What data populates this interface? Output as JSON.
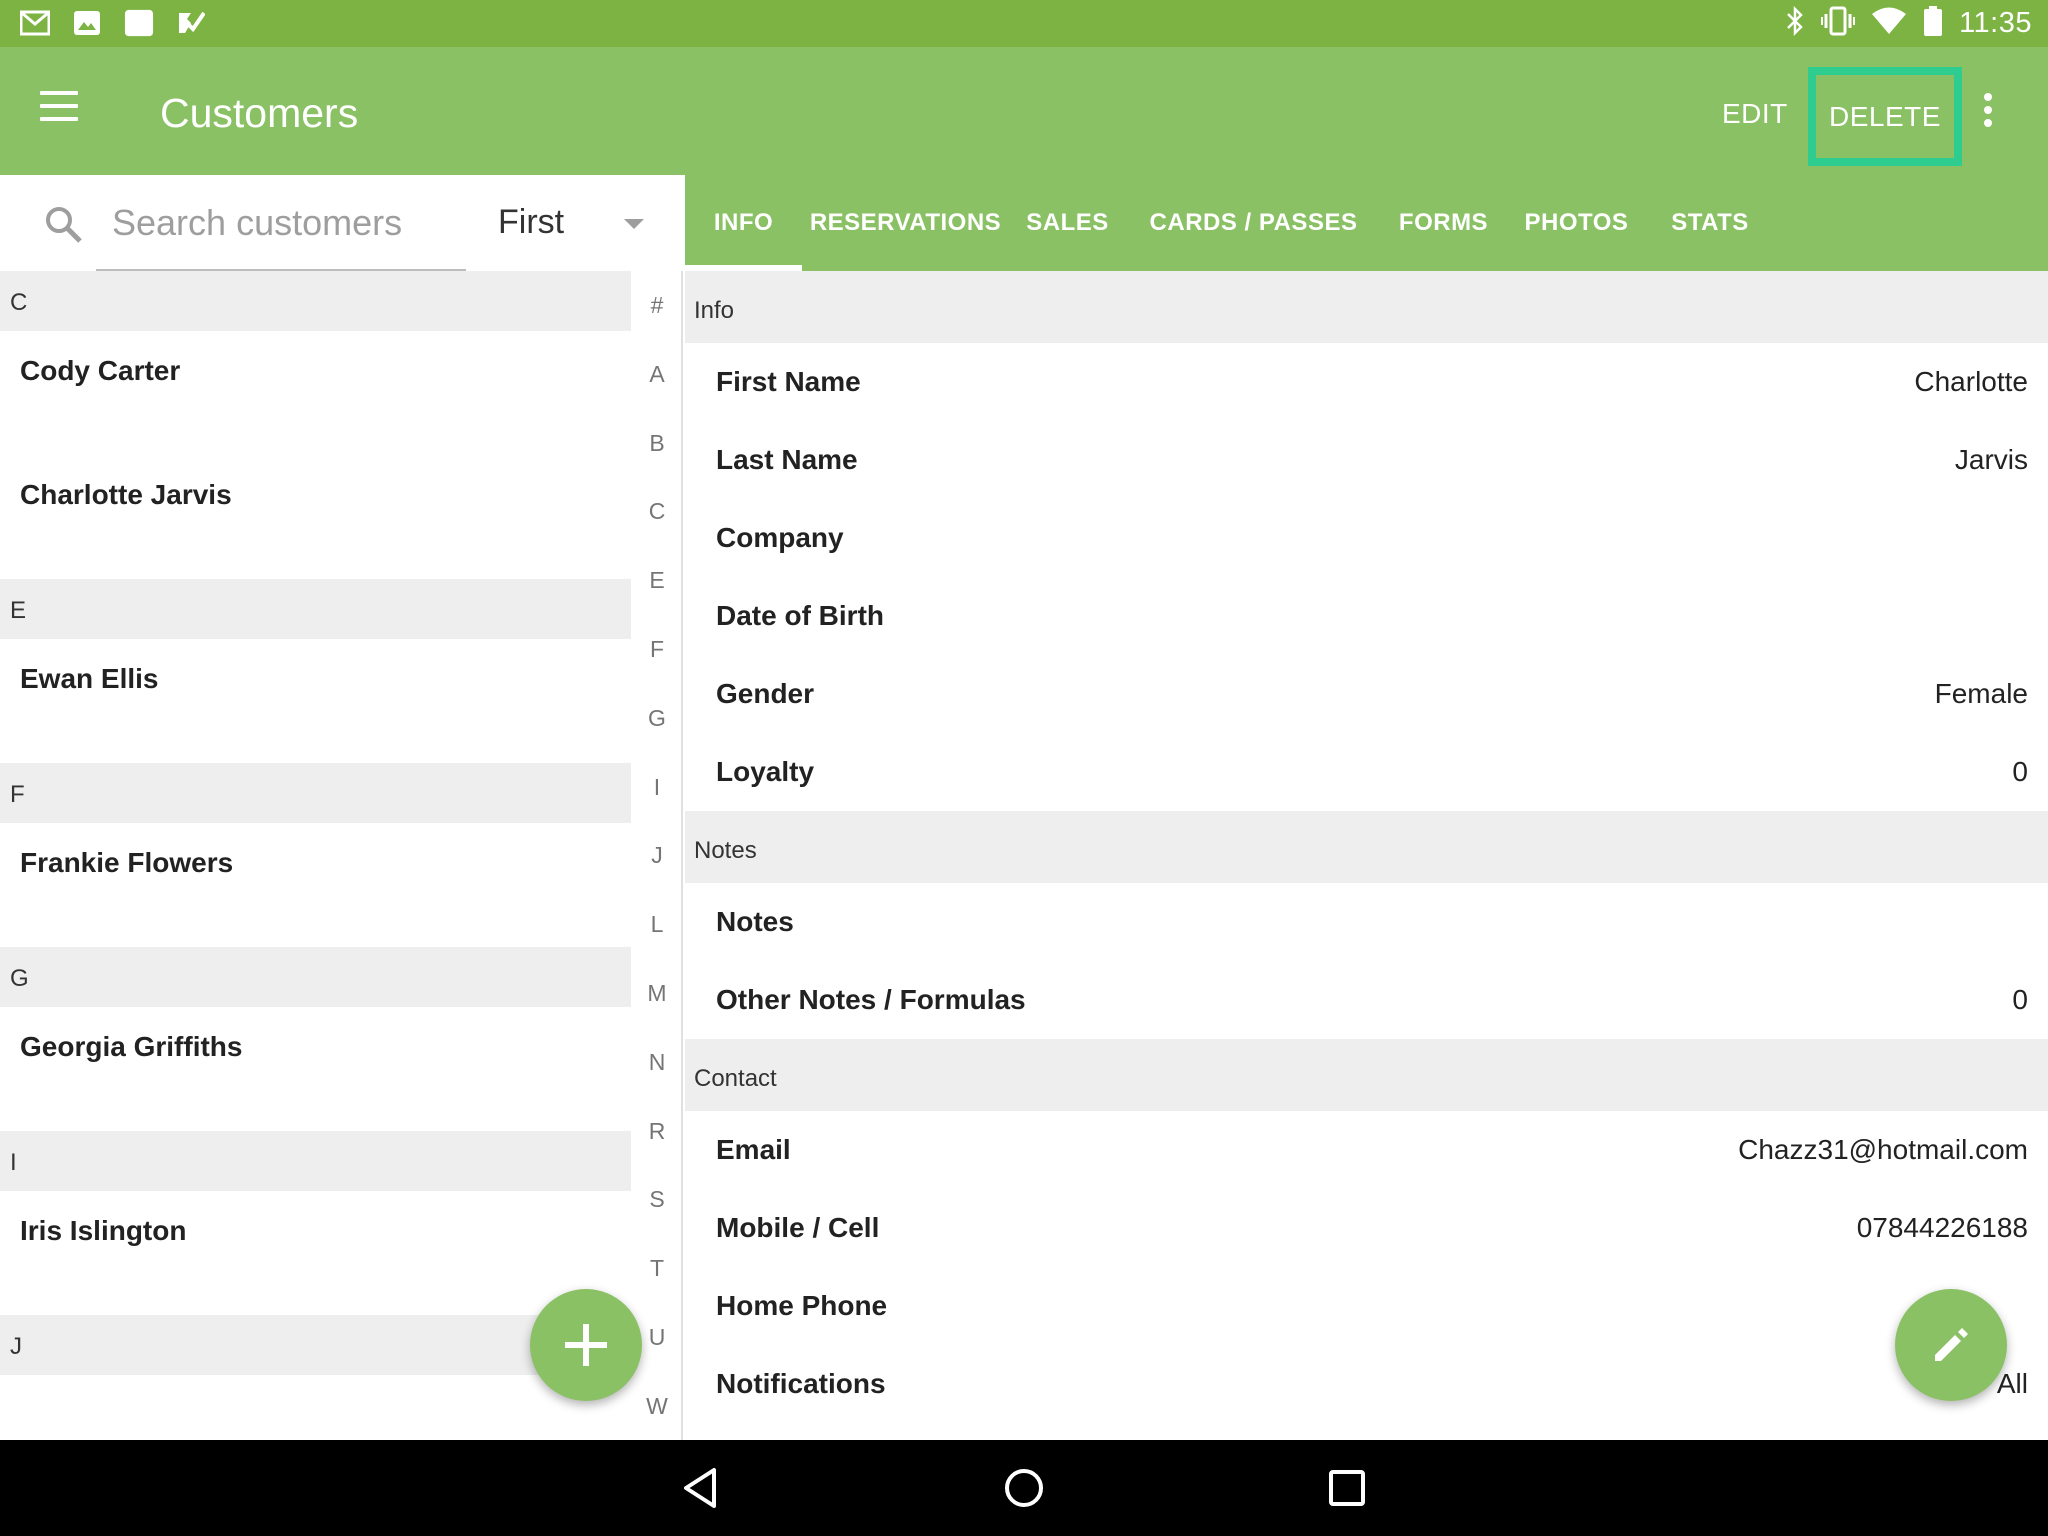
{
  "status_bar": {
    "time": "11:35",
    "left_icons": [
      "gmail-icon",
      "photos-icon",
      "blank-app-icon",
      "checkbox-app-icon"
    ],
    "right_icons": [
      "bluetooth-icon",
      "vibrate-icon",
      "wifi-icon",
      "battery-icon"
    ]
  },
  "app_bar": {
    "title": "Customers",
    "edit_label": "EDIT",
    "delete_label": "DELETE"
  },
  "search": {
    "placeholder": "Search customers",
    "sort_value": "First"
  },
  "customer_list": [
    {
      "section": "C",
      "names": [
        "Cody Carter",
        "Charlotte Jarvis"
      ]
    },
    {
      "section": "E",
      "names": [
        "Ewan Ellis"
      ]
    },
    {
      "section": "F",
      "names": [
        "Frankie Flowers"
      ]
    },
    {
      "section": "G",
      "names": [
        "Georgia Griffiths"
      ]
    },
    {
      "section": "I",
      "names": [
        "Iris Islington"
      ]
    },
    {
      "section": "J",
      "names": []
    }
  ],
  "alphabet": [
    "#",
    "A",
    "B",
    "C",
    "E",
    "F",
    "G",
    "I",
    "J",
    "L",
    "M",
    "N",
    "R",
    "S",
    "T",
    "U",
    "W"
  ],
  "tabs": [
    "INFO",
    "RESERVATIONS",
    "SALES",
    "CARDS / PASSES",
    "FORMS",
    "PHOTOS",
    "STATS"
  ],
  "active_tab": "INFO",
  "details": {
    "info_header": "Info",
    "first_name_label": "First Name",
    "first_name": "Charlotte",
    "last_name_label": "Last Name",
    "last_name": "Jarvis",
    "company_label": "Company",
    "company": "",
    "dob_label": "Date of Birth",
    "dob": "",
    "gender_label": "Gender",
    "gender": "Female",
    "loyalty_label": "Loyalty",
    "loyalty": "0",
    "notes_header": "Notes",
    "notes_label": "Notes",
    "notes": "",
    "other_notes_label": "Other Notes / Formulas",
    "other_notes": "0",
    "contact_header": "Contact",
    "email_label": "Email",
    "email": "Chazz31@hotmail.com",
    "mobile_label": "Mobile / Cell",
    "mobile": "07844226188",
    "home_phone_label": "Home Phone",
    "home_phone": "",
    "notifications_label": "Notifications",
    "notifications": "All"
  },
  "colors": {
    "status_bar": "#7cb342",
    "primary": "#8bc165",
    "highlight_border": "#2ecc8f",
    "section_bg": "#eeeeee"
  }
}
